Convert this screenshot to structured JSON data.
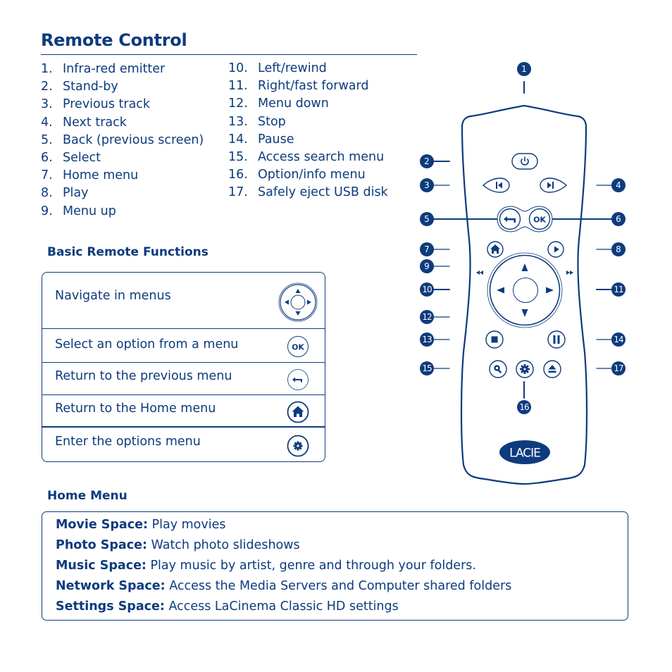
{
  "page": {
    "title": "Remote Control"
  },
  "legend": {
    "left": [
      {
        "num": "1.",
        "label": "Infra-red emitter"
      },
      {
        "num": "2.",
        "label": "Stand-by"
      },
      {
        "num": "3.",
        "label": "Previous track"
      },
      {
        "num": "4.",
        "label": "Next track"
      },
      {
        "num": "5.",
        "label": "Back (previous screen)"
      },
      {
        "num": "6.",
        "label": "Select"
      },
      {
        "num": "7.",
        "label": "Home menu"
      },
      {
        "num": "8.",
        "label": "Play"
      },
      {
        "num": "9.",
        "label": "Menu up"
      }
    ],
    "right": [
      {
        "num": "10.",
        "label": "Left/rewind"
      },
      {
        "num": "11.",
        "label": "Right/fast forward"
      },
      {
        "num": "12.",
        "label": "Menu down"
      },
      {
        "num": "13.",
        "label": "Stop"
      },
      {
        "num": "14.",
        "label": "Pause"
      },
      {
        "num": "15.",
        "label": "Access search menu"
      },
      {
        "num": "16.",
        "label": "Option/info menu"
      },
      {
        "num": "17.",
        "label": "Safely eject USB disk"
      }
    ]
  },
  "basic_functions": {
    "heading": "Basic Remote Functions",
    "rows": [
      {
        "label": "Navigate in menus",
        "icon": "dpad-icon"
      },
      {
        "label": "Select an option from a menu",
        "icon": "ok-icon",
        "icon_text": "OK"
      },
      {
        "label": "Return to the previous menu",
        "icon": "back-arrow-icon"
      },
      {
        "label": "Return to the Home menu",
        "icon": "home-icon"
      },
      {
        "label": "Enter the options menu",
        "icon": "gear-icon"
      }
    ]
  },
  "home_menu": {
    "heading": "Home Menu",
    "items": [
      {
        "name": "Movie Space:",
        "desc": " Play movies"
      },
      {
        "name": "Photo Space:",
        "desc": " Watch photo slideshows"
      },
      {
        "name": "Music Space:",
        "desc": " Play music by artist, genre and through your folders."
      },
      {
        "name": "Network Space:",
        "desc": " Access the Media Servers and Computer shared folders"
      },
      {
        "name": "Settings Space:",
        "desc": " Access LaCinema Classic HD settings"
      }
    ]
  },
  "remote": {
    "brand": "LACIE",
    "ok_label": "OK",
    "callouts": [
      "1",
      "2",
      "3",
      "4",
      "5",
      "6",
      "7",
      "8",
      "9",
      "10",
      "11",
      "12",
      "13",
      "14",
      "15",
      "16",
      "17"
    ]
  },
  "colors": {
    "primary": "#0d3b7d",
    "background": "#ffffff"
  }
}
